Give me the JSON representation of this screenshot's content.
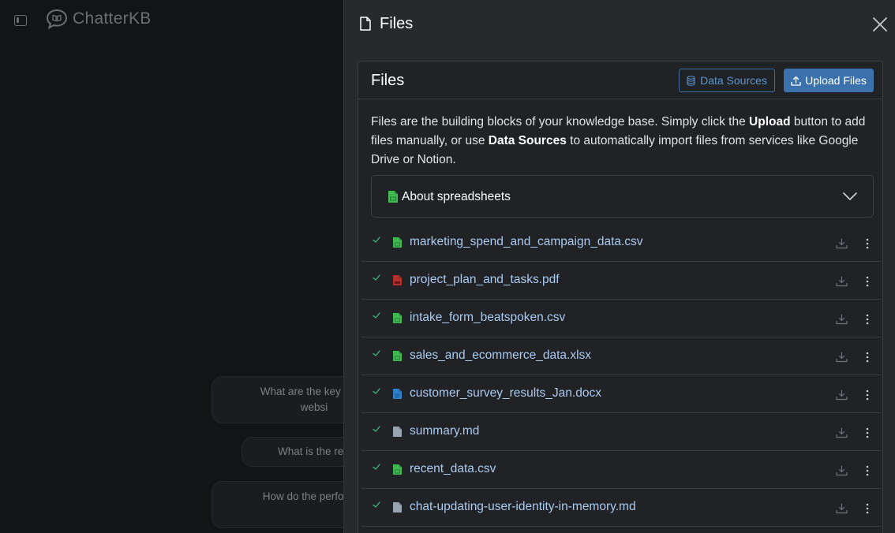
{
  "app": {
    "brand_name": "ChatterKB"
  },
  "background": {
    "suggestions": [
      "What are the key perfo\nwebsi",
      "What is the relatio",
      "How do the performar"
    ]
  },
  "drawer": {
    "title": "Files",
    "card_title": "Files",
    "data_sources_label": "Data Sources",
    "upload_label": "Upload Files",
    "intro": {
      "t1": "Files are the building blocks of your knowledge base. Simply click the ",
      "b1": "Upload",
      "t2": " button to add files manually, or use ",
      "b2": "Data Sources",
      "t3": " to automatically import files from services like Google Drive or Notion."
    },
    "accordion_label": "About spreadsheets",
    "files": [
      {
        "name": "marketing_spend_and_campaign_data.csv",
        "type": "spreadsheet"
      },
      {
        "name": "project_plan_and_tasks.pdf",
        "type": "pdf"
      },
      {
        "name": "intake_form_beatspoken.csv",
        "type": "spreadsheet"
      },
      {
        "name": "sales_and_ecommerce_data.xlsx",
        "type": "spreadsheet"
      },
      {
        "name": "customer_survey_results_Jan.docx",
        "type": "doc"
      },
      {
        "name": "summary.md",
        "type": "text"
      },
      {
        "name": "recent_data.csv",
        "type": "spreadsheet"
      },
      {
        "name": "chat-updating-user-identity-in-memory.md",
        "type": "text"
      }
    ]
  },
  "colors": {
    "spreadsheet": "#3fb950",
    "pdf": "#b2312e",
    "doc": "#2f80c8",
    "text": "#9aa4b1",
    "check": "#3fb97a",
    "link": "#a9cbf0",
    "accent": "#3b72ad"
  }
}
